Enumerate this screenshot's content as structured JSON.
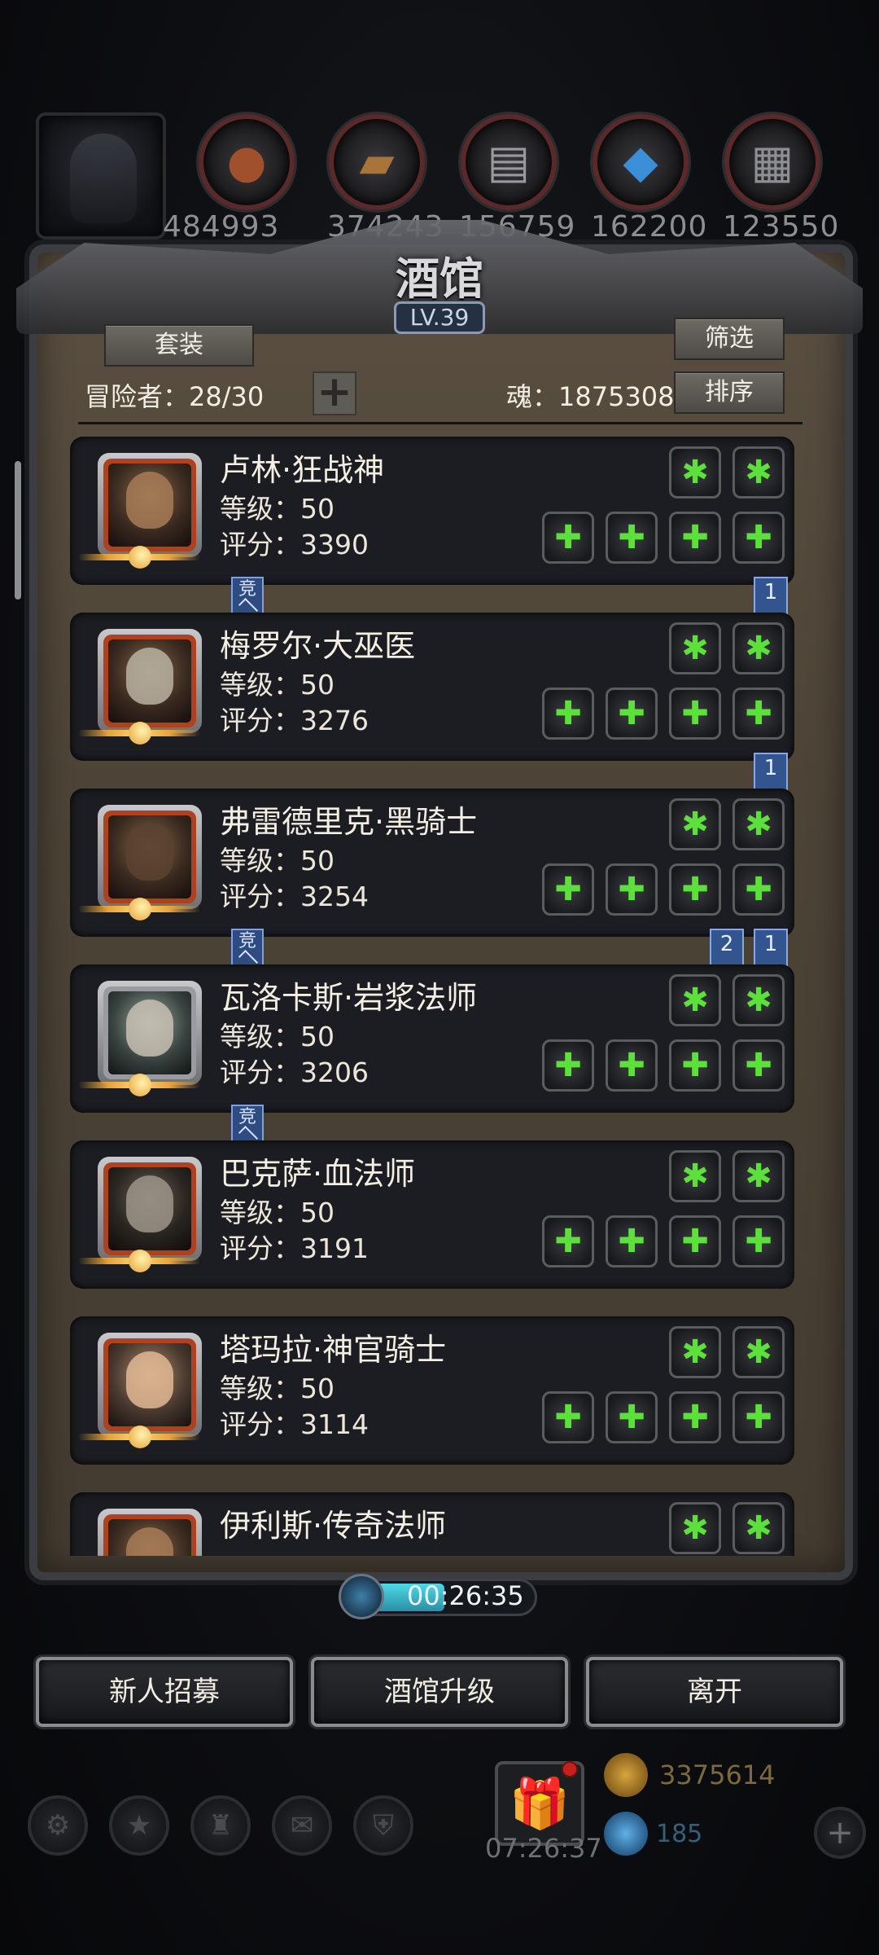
{
  "resources": [
    {
      "icon": "meat-icon",
      "value": "484993"
    },
    {
      "icon": "wood-icon",
      "value": "374243"
    },
    {
      "icon": "stone-icon",
      "value": "156759"
    },
    {
      "icon": "crystal-icon",
      "value": "162200"
    },
    {
      "icon": "iron-icon",
      "value": "123550"
    }
  ],
  "tavern": {
    "title": "酒馆",
    "level": "LV.39",
    "suit_button": "套装",
    "filter_button": "筛选",
    "sort_button": "排序",
    "adventurer_count": "冒险者：28/30",
    "soul": "魂：1875308",
    "add_symbol": "+"
  },
  "heroes": [
    {
      "name": "卢林·狂战神",
      "level": "等级：50",
      "score": "评分：3390"
    },
    {
      "name": "梅罗尔·大巫医",
      "level": "等级：50",
      "score": "评分：3276"
    },
    {
      "name": "弗雷德里克·黑骑士",
      "level": "等级：50",
      "score": "评分：3254"
    },
    {
      "name": "瓦洛卡斯·岩浆法师",
      "level": "等级：50",
      "score": "评分：3206"
    },
    {
      "name": "巴克萨·血法师",
      "level": "等级：50",
      "score": "评分：3191"
    },
    {
      "name": "塔玛拉·神官骑士",
      "level": "等级：50",
      "score": "评分：3114"
    },
    {
      "name": "伊利斯·传奇法师",
      "level": "",
      "score": ""
    }
  ],
  "badges": {
    "jing": "竞",
    "flag1": "1",
    "flag2": "2"
  },
  "timer": "00:26:35",
  "actions": {
    "recruit": "新人招募",
    "upgrade": "酒馆升级",
    "leave": "离开"
  },
  "footer": {
    "gift_timer": "07:26:37",
    "gold": "3375614",
    "gems": "185",
    "plus": "+"
  },
  "colors": {
    "accent_green": "#5ce03a",
    "panel": "#4d4437",
    "badge_blue": "#33558f"
  }
}
